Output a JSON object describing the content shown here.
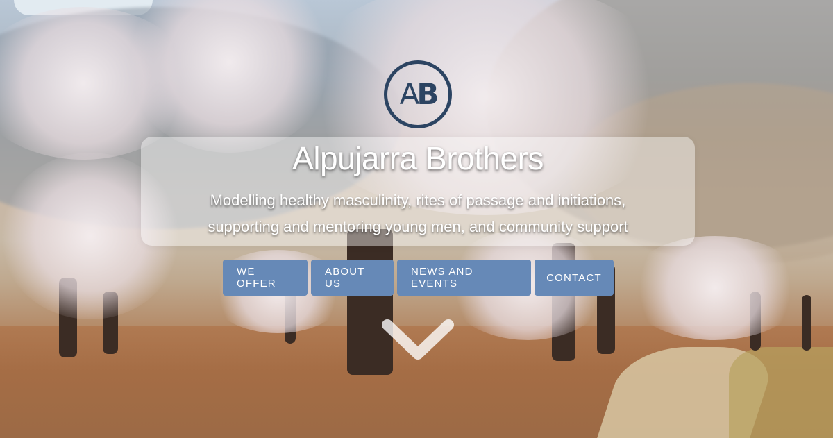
{
  "site": {
    "logo_text_a": "A",
    "logo_text_b": "B",
    "title": "Alpujarra Brothers",
    "tagline_line1": "Modelling healthy masculinity, rites of passage and initiations,",
    "tagline_line2": "supporting and mentoring young men, and community support"
  },
  "nav": {
    "items": [
      {
        "label": "WE OFFER"
      },
      {
        "label": "ABOUT US"
      },
      {
        "label": "NEWS AND EVENTS"
      },
      {
        "label": "CONTACT"
      }
    ]
  },
  "scroll": {
    "icon": "chevron-down-icon"
  },
  "colors": {
    "nav_button": "#6689b7",
    "logo": "#2c4462",
    "text": "#ffffff"
  }
}
